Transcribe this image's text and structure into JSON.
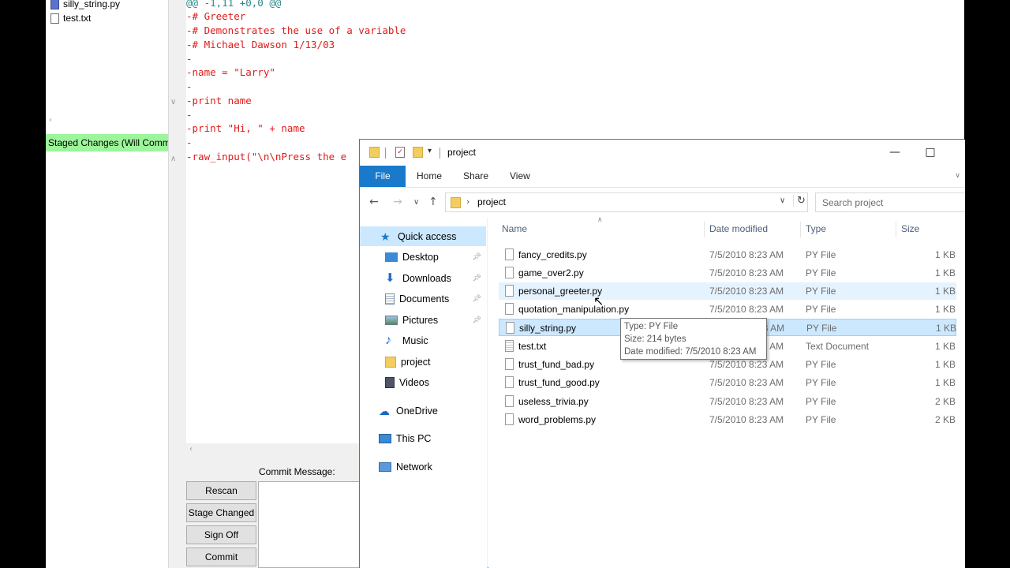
{
  "git_gui": {
    "unstaged_files": [
      {
        "name": "silly_string.py",
        "icon": "modified-file-icon"
      },
      {
        "name": "test.txt",
        "icon": "file-icon"
      }
    ],
    "staged_header": "Staged Changes (Will Commit)",
    "diff_lines": [
      "@@ -1,11 +0,0 @@",
      "-# Greeter",
      "-# Demonstrates the use of a variable",
      "-# Michael Dawson 1/13/03",
      "-",
      "-name = \"Larry\"",
      "-",
      "-print name",
      "-",
      "-print \"Hi, \" + name",
      "-",
      "-raw_input(\"\\n\\nPress the e"
    ],
    "commit_message_label": "Commit Message:",
    "buttons": [
      "Rescan",
      "Stage Changed",
      "Sign Off",
      "Commit"
    ]
  },
  "explorer": {
    "title": "project",
    "ribbon_tabs": [
      "File",
      "Home",
      "Share",
      "View"
    ],
    "address": "project",
    "search_placeholder": "Search project",
    "nav_items": [
      {
        "label": "Quick access",
        "icon": "star-icon",
        "pinned": false
      },
      {
        "label": "Desktop",
        "icon": "desktop-icon",
        "pinned": true
      },
      {
        "label": "Downloads",
        "icon": "download-icon",
        "pinned": true
      },
      {
        "label": "Documents",
        "icon": "documents-icon",
        "pinned": true
      },
      {
        "label": "Pictures",
        "icon": "pictures-icon",
        "pinned": true
      },
      {
        "label": "Music",
        "icon": "music-icon",
        "pinned": false
      },
      {
        "label": "project",
        "icon": "folder-icon",
        "pinned": false
      },
      {
        "label": "Videos",
        "icon": "videos-icon",
        "pinned": false
      },
      {
        "label": "OneDrive",
        "icon": "cloud-icon",
        "pinned": false
      },
      {
        "label": "This PC",
        "icon": "computer-icon",
        "pinned": false
      },
      {
        "label": "Network",
        "icon": "network-icon",
        "pinned": false
      }
    ],
    "columns": [
      "Name",
      "Date modified",
      "Type",
      "Size"
    ],
    "files": [
      {
        "name": "fancy_credits.py",
        "date": "7/5/2010 8:23 AM",
        "type": "PY File",
        "size": "1 KB"
      },
      {
        "name": "game_over2.py",
        "date": "7/5/2010 8:23 AM",
        "type": "PY File",
        "size": "1 KB"
      },
      {
        "name": "personal_greeter.py",
        "date": "7/5/2010 8:23 AM",
        "type": "PY File",
        "size": "1 KB"
      },
      {
        "name": "quotation_manipulation.py",
        "date": "7/5/2010 8:23 AM",
        "type": "PY File",
        "size": "1 KB"
      },
      {
        "name": "silly_string.py",
        "date": "7/5/2010 8:23 AM",
        "type": "PY File",
        "size": "1 KB"
      },
      {
        "name": "test.txt",
        "date": "7/5/2010 8:23 AM",
        "type": "Text Document",
        "size": "1 KB"
      },
      {
        "name": "trust_fund_bad.py",
        "date": "7/5/2010 8:23 AM",
        "type": "PY File",
        "size": "1 KB"
      },
      {
        "name": "trust_fund_good.py",
        "date": "7/5/2010 8:23 AM",
        "type": "PY File",
        "size": "1 KB"
      },
      {
        "name": "useless_trivia.py",
        "date": "7/5/2010 8:23 AM",
        "type": "PY File",
        "size": "2 KB"
      },
      {
        "name": "word_problems.py",
        "date": "7/5/2010 8:23 AM",
        "type": "PY File",
        "size": "2 KB"
      }
    ],
    "tooltip": {
      "type_line": "Type: PY File",
      "size_line": "Size: 214 bytes",
      "date_line": "Date modified: 7/5/2010 8:23 AM"
    }
  },
  "colors": {
    "staged_header_bg": "#9cf59a",
    "diff_removed": "#e01a1a",
    "ribbon_file_tab": "#1979ca",
    "selection": "#cce8ff"
  }
}
